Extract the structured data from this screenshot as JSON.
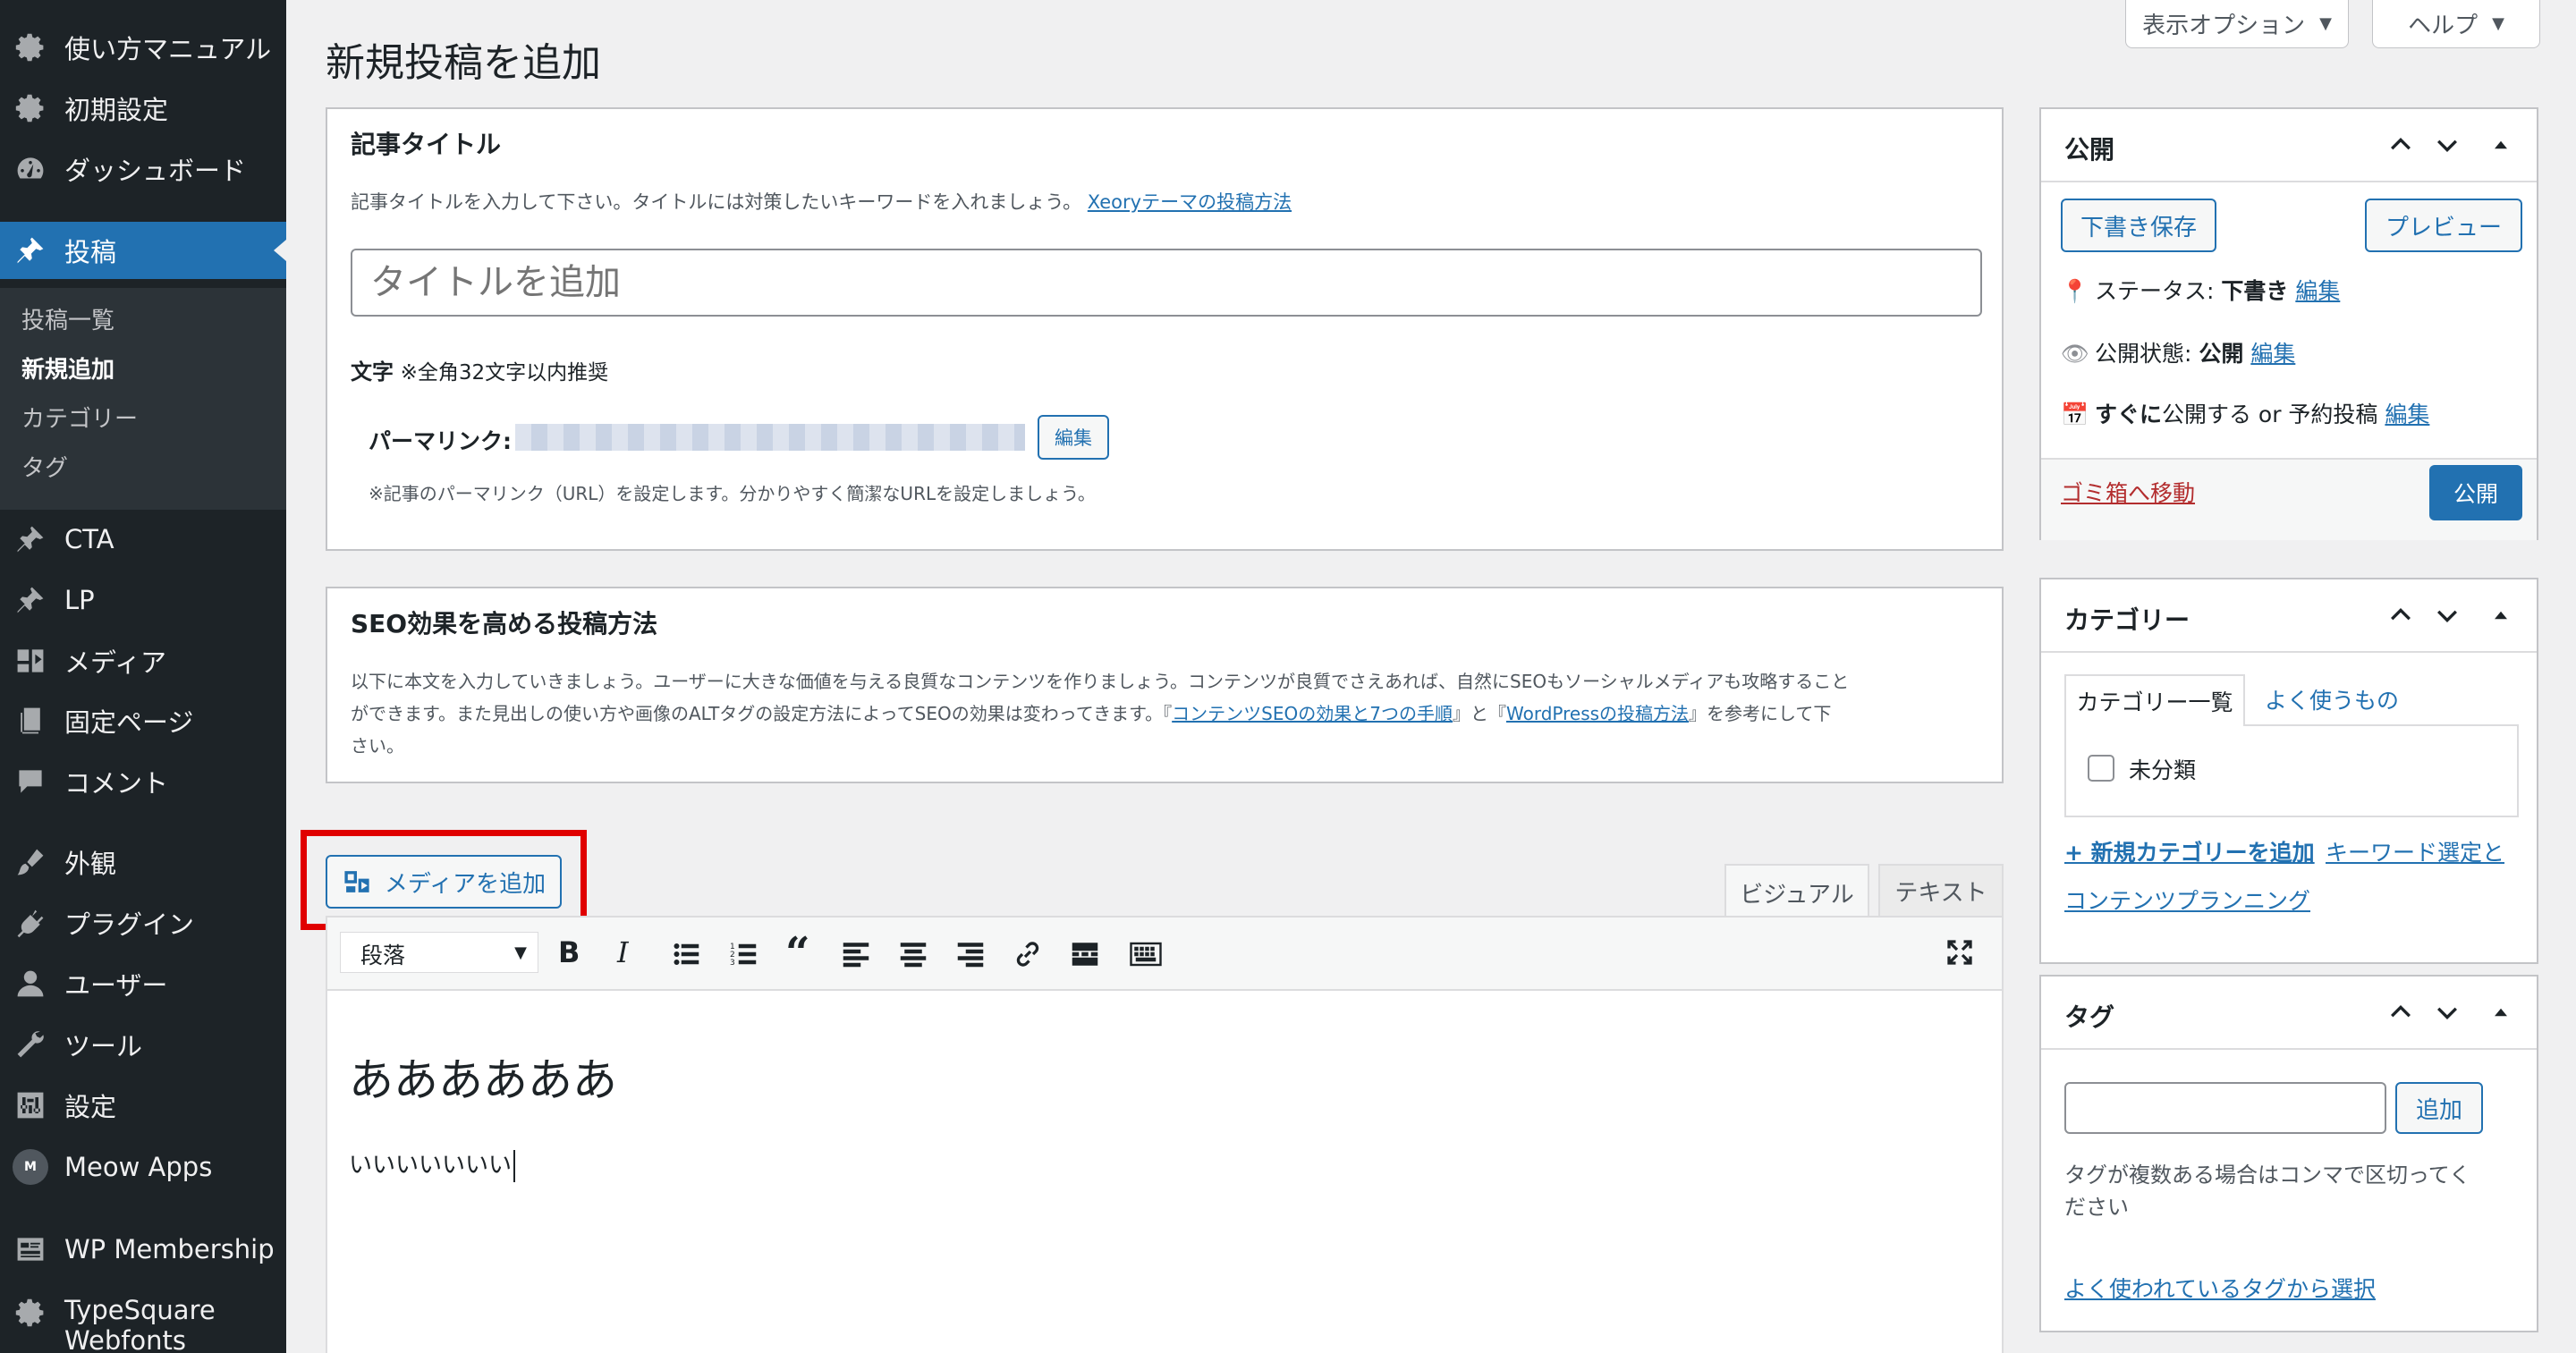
{
  "sidebar": {
    "items": [
      {
        "label": "使い方マニュアル",
        "icon": "gear-icon"
      },
      {
        "label": "初期設定",
        "icon": "gear-icon"
      },
      {
        "label": "ダッシュボード",
        "icon": "dashboard-gauge-icon"
      },
      {
        "label": "投稿",
        "icon": "pin-icon"
      },
      {
        "label": "CTA",
        "icon": "pin-icon"
      },
      {
        "label": "LP",
        "icon": "pin-icon"
      },
      {
        "label": "メディア",
        "icon": "media-icon"
      },
      {
        "label": "固定ページ",
        "icon": "page-icon"
      },
      {
        "label": "コメント",
        "icon": "comment-icon"
      },
      {
        "label": "外観",
        "icon": "brush-icon"
      },
      {
        "label": "プラグイン",
        "icon": "plugin-icon"
      },
      {
        "label": "ユーザー",
        "icon": "user-icon"
      },
      {
        "label": "ツール",
        "icon": "wrench-icon"
      },
      {
        "label": "設定",
        "icon": "settings-sliders-icon"
      },
      {
        "label": "Meow Apps",
        "icon": "meow-apps-icon"
      },
      {
        "label": "WP Membership",
        "icon": "membership-icon"
      },
      {
        "label": "TypeSquare",
        "icon": "gear-icon"
      },
      {
        "label": "Webfonts",
        "icon": ""
      }
    ],
    "submenu": [
      "投稿一覧",
      "新規追加",
      "カテゴリー",
      "タグ"
    ]
  },
  "header": {
    "title": "新規投稿を追加",
    "screen_options": "表示オプション",
    "help": "ヘルプ"
  },
  "title_box": {
    "heading": "記事タイトル",
    "desc": "記事タイトルを入力して下さい。タイトルには対策したいキーワードを入れましょう。",
    "link": "Xeoryテーマの投稿方法",
    "placeholder": "タイトルを追加",
    "count_label": "文字",
    "count_note": "※全角32文字以内推奨",
    "permalink_label": "パーマリンク:",
    "edit": "編集",
    "permalink_note": "※記事のパーマリンク（URL）を設定します。分かりやすく簡潔なURLを設定しましょう。"
  },
  "seo_box": {
    "heading": "SEO効果を高める投稿方法",
    "line1": "以下に本文を入力していきましょう。ユーザーに大きな価値を与える良質なコンテンツを作りましょう。コンテンツが良質でさえあれば、自然にSEOもソーシャルメディアも攻略すること",
    "line2a": "ができます。また見出しの使い方や画像のALTタグの設定方法によってSEOの効果は変わってきます。『",
    "link1": "コンテンツSEOの効果と7つの手順",
    "mid": "』と『",
    "link2": "WordPressの投稿方法",
    "line2b": "』を参考にして下",
    "line3": "さい。"
  },
  "editor": {
    "add_media": "メディアを追加",
    "tab_visual": "ビジュアル",
    "tab_text": "テキスト",
    "format": "段落",
    "heading_text": "ああああああ",
    "body_text": "いいいいいいい"
  },
  "publish": {
    "heading": "公開",
    "save_draft": "下書き保存",
    "preview": "プレビュー",
    "status_label": "ステータス:",
    "status_value": "下書き",
    "visibility_label": "公開状態:",
    "visibility_value": "公開",
    "schedule_bold": "すぐに",
    "schedule_text": "公開する or 予約投稿",
    "edit": "編集",
    "trash": "ゴミ箱へ移動",
    "publish": "公開"
  },
  "category": {
    "heading": "カテゴリー",
    "tab_all": "カテゴリー一覧",
    "tab_popular": "よく使うもの",
    "item": "未分類",
    "add_new": "+ 新規カテゴリーを追加",
    "keyword_link1": "キーワード選定と",
    "keyword_link2": "コンテンツプランニング"
  },
  "tags": {
    "heading": "タグ",
    "add": "追加",
    "help1": "タグが複数ある場合はコンマで区切ってく",
    "help2": "ださい",
    "choose": "よく使われているタグから選択"
  },
  "colors": {
    "accent": "#2271b1",
    "sidebar": "#1d2327",
    "highlight": "#e00000",
    "trash": "#b32d2e"
  }
}
